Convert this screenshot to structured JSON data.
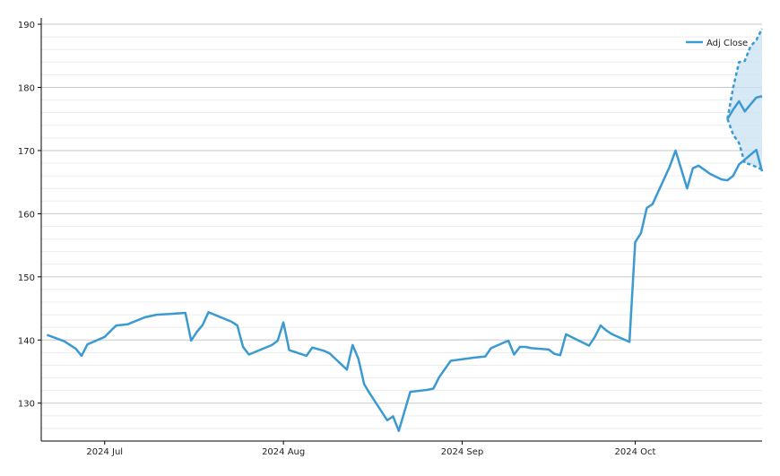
{
  "chart_data": {
    "type": "line",
    "title": "",
    "xlabel": "",
    "ylabel": "",
    "ylim": [
      124,
      191
    ],
    "xlim": [
      "2024-06-20",
      "2024-10-23"
    ],
    "yticks": [
      130,
      140,
      150,
      160,
      170,
      180,
      190
    ],
    "xticks": [
      {
        "date": "2024-07-01",
        "label": "2024 Jul"
      },
      {
        "date": "2024-08-01",
        "label": "2024 Aug"
      },
      {
        "date": "2024-09-01",
        "label": "2024 Sep"
      },
      {
        "date": "2024-10-01",
        "label": "2024 Oct"
      }
    ],
    "grid": {
      "major": true,
      "minor": true,
      "minor_step": 2
    },
    "legend": {
      "position": "top-right",
      "entries": [
        "Adj Close"
      ]
    },
    "colors": {
      "line": "#3a9ad1",
      "band_fill": "#c9e2f2",
      "grid_major": "#c8c8c8",
      "grid_minor": "#ececec",
      "axis": "#000000"
    },
    "series": [
      {
        "name": "Adj Close",
        "points": [
          [
            "2024-06-21",
            140.8
          ],
          [
            "2024-06-24",
            139.8
          ],
          [
            "2024-06-25",
            139.2
          ],
          [
            "2024-06-26",
            138.6
          ],
          [
            "2024-06-27",
            137.5
          ],
          [
            "2024-06-28",
            139.3
          ],
          [
            "2024-07-01",
            140.5
          ],
          [
            "2024-07-02",
            141.4
          ],
          [
            "2024-07-03",
            142.3
          ],
          [
            "2024-07-05",
            142.5
          ],
          [
            "2024-07-08",
            143.6
          ],
          [
            "2024-07-09",
            143.8
          ],
          [
            "2024-07-10",
            144.0
          ],
          [
            "2024-07-12",
            144.1
          ],
          [
            "2024-07-15",
            144.3
          ],
          [
            "2024-07-16",
            139.9
          ],
          [
            "2024-07-17",
            141.3
          ],
          [
            "2024-07-18",
            142.4
          ],
          [
            "2024-07-19",
            144.4
          ],
          [
            "2024-07-23",
            142.9
          ],
          [
            "2024-07-24",
            142.3
          ],
          [
            "2024-07-25",
            138.9
          ],
          [
            "2024-07-26",
            137.7
          ],
          [
            "2024-07-30",
            139.2
          ],
          [
            "2024-07-31",
            139.9
          ],
          [
            "2024-08-01",
            142.8
          ],
          [
            "2024-08-02",
            138.4
          ],
          [
            "2024-08-05",
            137.5
          ],
          [
            "2024-08-06",
            138.8
          ],
          [
            "2024-08-08",
            138.3
          ],
          [
            "2024-08-09",
            137.9
          ],
          [
            "2024-08-12",
            135.3
          ],
          [
            "2024-08-13",
            139.2
          ],
          [
            "2024-08-14",
            137.0
          ],
          [
            "2024-08-15",
            133.0
          ],
          [
            "2024-08-16",
            131.5
          ],
          [
            "2024-08-19",
            127.3
          ],
          [
            "2024-08-20",
            127.9
          ],
          [
            "2024-08-21",
            125.6
          ],
          [
            "2024-08-22",
            128.7
          ],
          [
            "2024-08-23",
            131.8
          ],
          [
            "2024-08-26",
            132.1
          ],
          [
            "2024-08-27",
            132.3
          ],
          [
            "2024-08-28",
            134.1
          ],
          [
            "2024-08-30",
            136.7
          ],
          [
            "2024-09-03",
            137.2
          ],
          [
            "2024-09-05",
            137.4
          ],
          [
            "2024-09-06",
            138.7
          ],
          [
            "2024-09-09",
            139.9
          ],
          [
            "2024-09-10",
            137.7
          ],
          [
            "2024-09-11",
            138.9
          ],
          [
            "2024-09-12",
            138.9
          ],
          [
            "2024-09-13",
            138.7
          ],
          [
            "2024-09-16",
            138.5
          ],
          [
            "2024-09-17",
            137.8
          ],
          [
            "2024-09-18",
            137.6
          ],
          [
            "2024-09-19",
            140.9
          ],
          [
            "2024-09-23",
            139.1
          ],
          [
            "2024-09-24",
            140.5
          ],
          [
            "2024-09-25",
            142.3
          ],
          [
            "2024-09-26",
            141.5
          ],
          [
            "2024-09-27",
            140.9
          ],
          [
            "2024-09-30",
            139.7
          ],
          [
            "2024-10-01",
            155.5
          ],
          [
            "2024-10-02",
            156.9
          ],
          [
            "2024-10-03",
            160.9
          ],
          [
            "2024-10-04",
            161.5
          ],
          [
            "2024-10-07",
            167.5
          ],
          [
            "2024-10-08",
            170.0
          ],
          [
            "2024-10-10",
            164.0
          ],
          [
            "2024-10-11",
            167.2
          ],
          [
            "2024-10-12",
            167.6
          ],
          [
            "2024-10-14",
            166.3
          ],
          [
            "2024-10-16",
            165.4
          ],
          [
            "2024-10-17",
            165.3
          ],
          [
            "2024-10-18",
            166.0
          ],
          [
            "2024-10-19",
            167.8
          ],
          [
            "2024-10-22",
            170.1
          ],
          [
            "2024-10-23",
            166.7
          ]
        ]
      }
    ]
  }
}
